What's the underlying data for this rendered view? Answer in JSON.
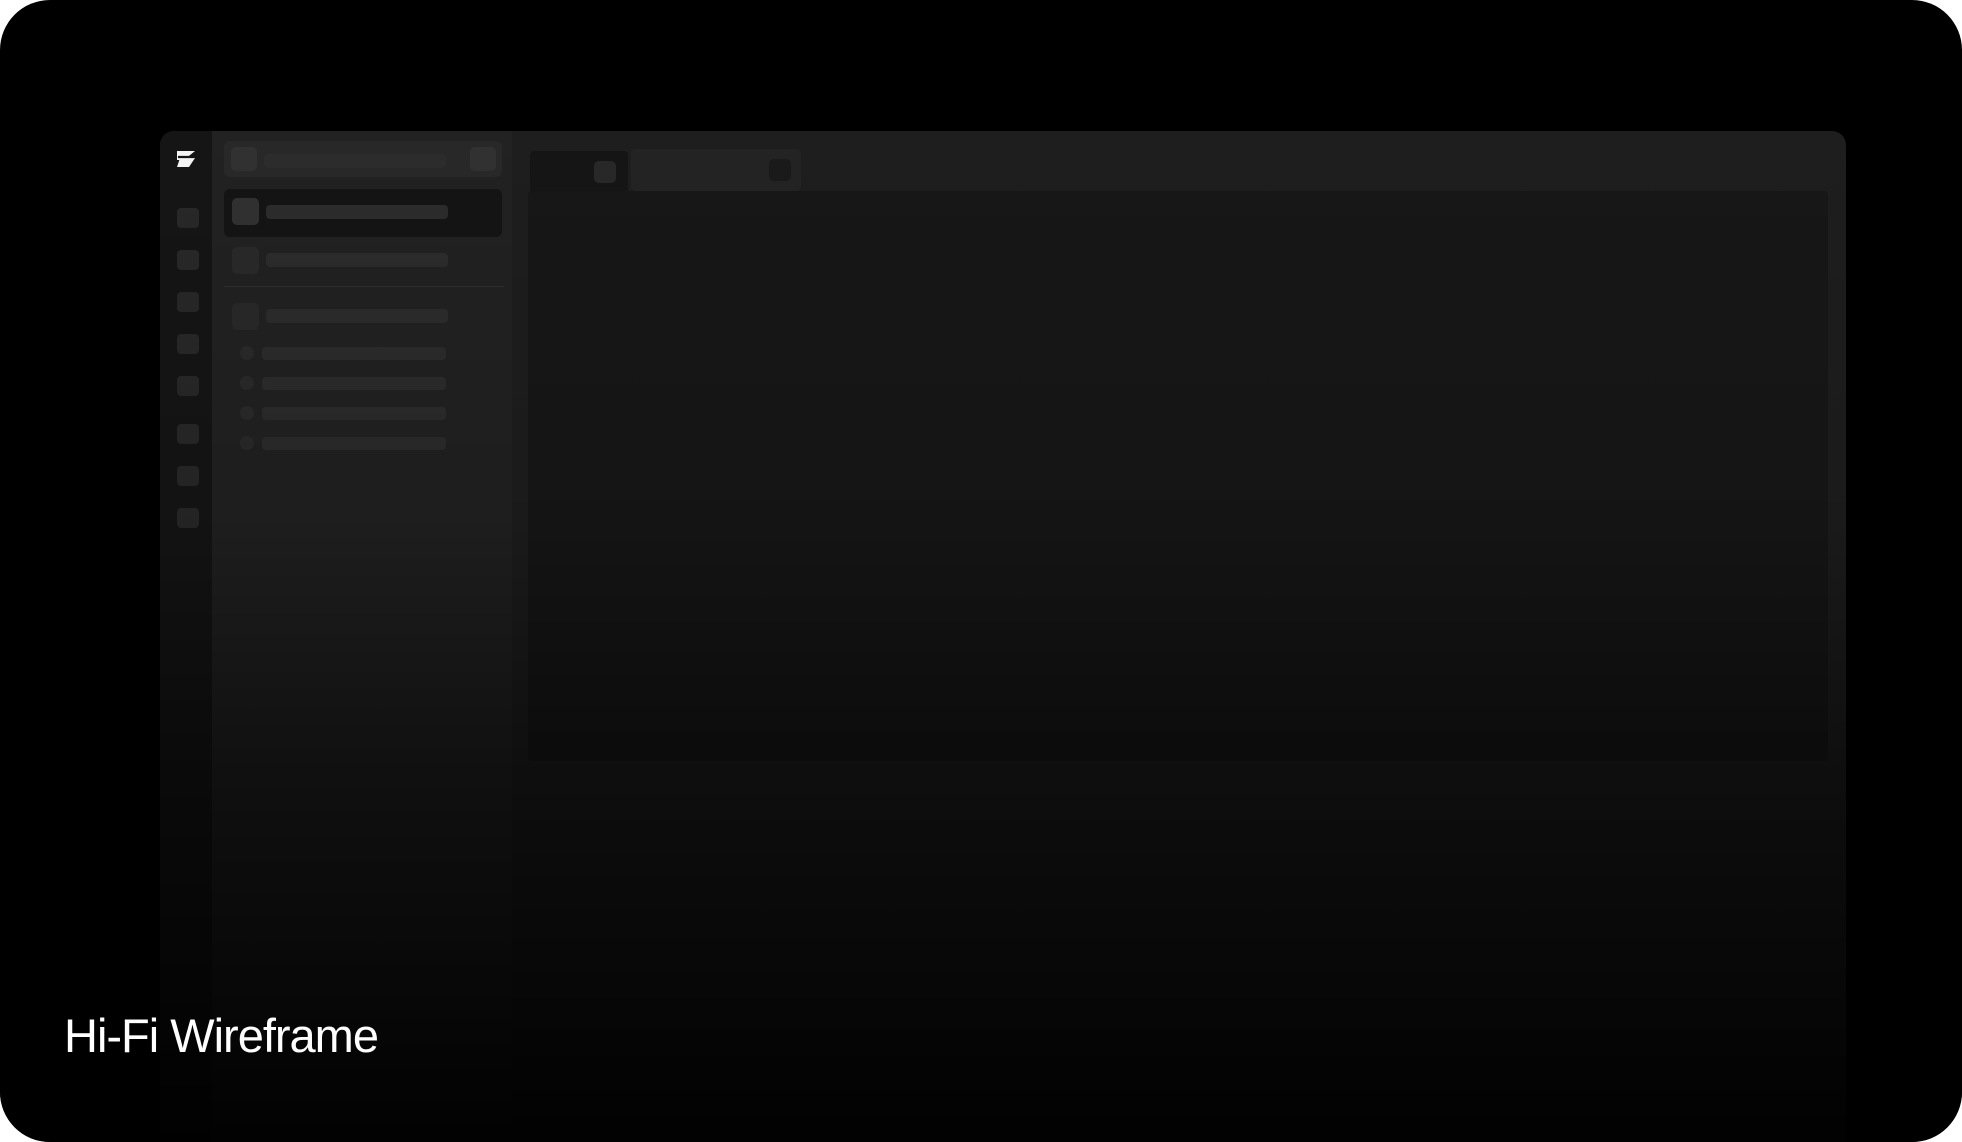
{
  "caption": {
    "text": "Hi-Fi Wireframe"
  },
  "app": {
    "logo_icon": "z-logo-icon"
  },
  "colors": {
    "background": "#000000",
    "app_surface": "#1f1f1f",
    "caption_text": "#ffffff"
  }
}
